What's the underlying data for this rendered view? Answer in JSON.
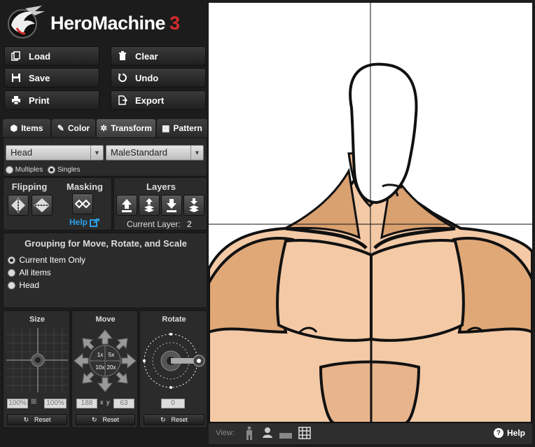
{
  "app": {
    "title": "HeroMachine",
    "version": "3"
  },
  "toolbar": {
    "load": "Load",
    "clear": "Clear",
    "save": "Save",
    "undo": "Undo",
    "print": "Print",
    "export": "Export"
  },
  "tabs": [
    {
      "label": "Items"
    },
    {
      "label": "Color"
    },
    {
      "label": "Transform"
    },
    {
      "label": "Pattern"
    }
  ],
  "selectors": {
    "category": "Head",
    "item": "MaleStandard"
  },
  "mode": {
    "multiples": "Multiples",
    "singles": "Singles",
    "selected": "Singles"
  },
  "flipping": {
    "title": "Flipping"
  },
  "masking": {
    "title": "Masking",
    "help": "Help"
  },
  "layers": {
    "title": "Layers",
    "current_label": "Current Layer:",
    "current_value": "2"
  },
  "grouping": {
    "title": "Grouping for Move, Rotate, and Scale",
    "options": [
      "Current Item Only",
      "All items",
      "Head"
    ],
    "selected": "Current Item Only"
  },
  "size": {
    "title": "Size",
    "width": "100%",
    "height": "100%",
    "reset": "Reset"
  },
  "move": {
    "title": "Move",
    "x": "188",
    "x_label": "x",
    "y_label": "y",
    "y": "63",
    "steps": [
      "1x",
      "5x",
      "10x",
      "20x"
    ],
    "reset": "Reset"
  },
  "rotate": {
    "title": "Rotate",
    "angle": "0",
    "reset": "Reset"
  },
  "view": {
    "label": "View:",
    "help": "Help"
  },
  "colors": {
    "accent": "#d52b2b",
    "link": "#2aa0e8",
    "skin": "#f3c9a6",
    "skin_shadow": "#d9a070",
    "outline": "#111111"
  }
}
